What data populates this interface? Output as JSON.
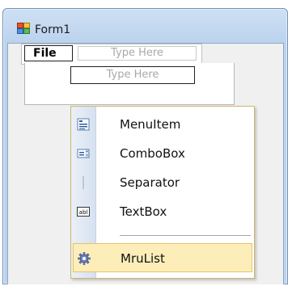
{
  "window": {
    "title": "Form1",
    "app_icon": "winform-icon"
  },
  "menubar": {
    "file_label": "File",
    "type_here_top": "Type Here"
  },
  "dropdown": {
    "type_here": "Type Here"
  },
  "popup_menu": {
    "items": [
      {
        "label": "MenuItem",
        "icon": "menuitem-icon"
      },
      {
        "label": "ComboBox",
        "icon": "combobox-icon"
      },
      {
        "label": "Separator",
        "icon": "separator-icon"
      },
      {
        "label": "TextBox",
        "icon": "textbox-icon"
      },
      {
        "label": "MruList",
        "icon": "gear-icon",
        "highlighted": true
      }
    ],
    "highlight_color": "#fdeeb9",
    "highlight_border": "#e3c36a"
  }
}
